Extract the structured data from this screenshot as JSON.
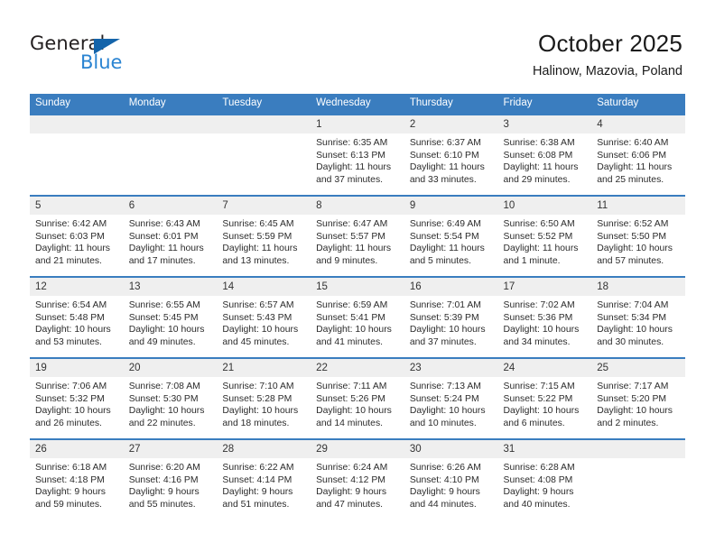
{
  "logo": {
    "word_dark": "General",
    "word_blue": "Blue",
    "triangle_color": "#1464aa",
    "blue_color": "#2a84d2"
  },
  "header": {
    "title": "October 2025",
    "subtitle": "Halinow, Mazovia, Poland"
  },
  "theme": {
    "header_row_bg": "#3a7dbf",
    "daynum_bg": "#efefef",
    "row_divider": "#3a7dbf"
  },
  "weekdays": [
    "Sunday",
    "Monday",
    "Tuesday",
    "Wednesday",
    "Thursday",
    "Friday",
    "Saturday"
  ],
  "labels": {
    "sunrise_prefix": "Sunrise:",
    "sunset_prefix": "Sunset:",
    "daylight_prefix": "Daylight:"
  },
  "weeks": [
    [
      {
        "day": "",
        "line1": "",
        "line2": "",
        "line3": "",
        "line4": ""
      },
      {
        "day": "",
        "line1": "",
        "line2": "",
        "line3": "",
        "line4": ""
      },
      {
        "day": "",
        "line1": "",
        "line2": "",
        "line3": "",
        "line4": ""
      },
      {
        "day": "1",
        "line1": "Sunrise: 6:35 AM",
        "line2": "Sunset: 6:13 PM",
        "line3": "Daylight: 11 hours",
        "line4": "and 37 minutes."
      },
      {
        "day": "2",
        "line1": "Sunrise: 6:37 AM",
        "line2": "Sunset: 6:10 PM",
        "line3": "Daylight: 11 hours",
        "line4": "and 33 minutes."
      },
      {
        "day": "3",
        "line1": "Sunrise: 6:38 AM",
        "line2": "Sunset: 6:08 PM",
        "line3": "Daylight: 11 hours",
        "line4": "and 29 minutes."
      },
      {
        "day": "4",
        "line1": "Sunrise: 6:40 AM",
        "line2": "Sunset: 6:06 PM",
        "line3": "Daylight: 11 hours",
        "line4": "and 25 minutes."
      }
    ],
    [
      {
        "day": "5",
        "line1": "Sunrise: 6:42 AM",
        "line2": "Sunset: 6:03 PM",
        "line3": "Daylight: 11 hours",
        "line4": "and 21 minutes."
      },
      {
        "day": "6",
        "line1": "Sunrise: 6:43 AM",
        "line2": "Sunset: 6:01 PM",
        "line3": "Daylight: 11 hours",
        "line4": "and 17 minutes."
      },
      {
        "day": "7",
        "line1": "Sunrise: 6:45 AM",
        "line2": "Sunset: 5:59 PM",
        "line3": "Daylight: 11 hours",
        "line4": "and 13 minutes."
      },
      {
        "day": "8",
        "line1": "Sunrise: 6:47 AM",
        "line2": "Sunset: 5:57 PM",
        "line3": "Daylight: 11 hours",
        "line4": "and 9 minutes."
      },
      {
        "day": "9",
        "line1": "Sunrise: 6:49 AM",
        "line2": "Sunset: 5:54 PM",
        "line3": "Daylight: 11 hours",
        "line4": "and 5 minutes."
      },
      {
        "day": "10",
        "line1": "Sunrise: 6:50 AM",
        "line2": "Sunset: 5:52 PM",
        "line3": "Daylight: 11 hours",
        "line4": "and 1 minute."
      },
      {
        "day": "11",
        "line1": "Sunrise: 6:52 AM",
        "line2": "Sunset: 5:50 PM",
        "line3": "Daylight: 10 hours",
        "line4": "and 57 minutes."
      }
    ],
    [
      {
        "day": "12",
        "line1": "Sunrise: 6:54 AM",
        "line2": "Sunset: 5:48 PM",
        "line3": "Daylight: 10 hours",
        "line4": "and 53 minutes."
      },
      {
        "day": "13",
        "line1": "Sunrise: 6:55 AM",
        "line2": "Sunset: 5:45 PM",
        "line3": "Daylight: 10 hours",
        "line4": "and 49 minutes."
      },
      {
        "day": "14",
        "line1": "Sunrise: 6:57 AM",
        "line2": "Sunset: 5:43 PM",
        "line3": "Daylight: 10 hours",
        "line4": "and 45 minutes."
      },
      {
        "day": "15",
        "line1": "Sunrise: 6:59 AM",
        "line2": "Sunset: 5:41 PM",
        "line3": "Daylight: 10 hours",
        "line4": "and 41 minutes."
      },
      {
        "day": "16",
        "line1": "Sunrise: 7:01 AM",
        "line2": "Sunset: 5:39 PM",
        "line3": "Daylight: 10 hours",
        "line4": "and 37 minutes."
      },
      {
        "day": "17",
        "line1": "Sunrise: 7:02 AM",
        "line2": "Sunset: 5:36 PM",
        "line3": "Daylight: 10 hours",
        "line4": "and 34 minutes."
      },
      {
        "day": "18",
        "line1": "Sunrise: 7:04 AM",
        "line2": "Sunset: 5:34 PM",
        "line3": "Daylight: 10 hours",
        "line4": "and 30 minutes."
      }
    ],
    [
      {
        "day": "19",
        "line1": "Sunrise: 7:06 AM",
        "line2": "Sunset: 5:32 PM",
        "line3": "Daylight: 10 hours",
        "line4": "and 26 minutes."
      },
      {
        "day": "20",
        "line1": "Sunrise: 7:08 AM",
        "line2": "Sunset: 5:30 PM",
        "line3": "Daylight: 10 hours",
        "line4": "and 22 minutes."
      },
      {
        "day": "21",
        "line1": "Sunrise: 7:10 AM",
        "line2": "Sunset: 5:28 PM",
        "line3": "Daylight: 10 hours",
        "line4": "and 18 minutes."
      },
      {
        "day": "22",
        "line1": "Sunrise: 7:11 AM",
        "line2": "Sunset: 5:26 PM",
        "line3": "Daylight: 10 hours",
        "line4": "and 14 minutes."
      },
      {
        "day": "23",
        "line1": "Sunrise: 7:13 AM",
        "line2": "Sunset: 5:24 PM",
        "line3": "Daylight: 10 hours",
        "line4": "and 10 minutes."
      },
      {
        "day": "24",
        "line1": "Sunrise: 7:15 AM",
        "line2": "Sunset: 5:22 PM",
        "line3": "Daylight: 10 hours",
        "line4": "and 6 minutes."
      },
      {
        "day": "25",
        "line1": "Sunrise: 7:17 AM",
        "line2": "Sunset: 5:20 PM",
        "line3": "Daylight: 10 hours",
        "line4": "and 2 minutes."
      }
    ],
    [
      {
        "day": "26",
        "line1": "Sunrise: 6:18 AM",
        "line2": "Sunset: 4:18 PM",
        "line3": "Daylight: 9 hours",
        "line4": "and 59 minutes."
      },
      {
        "day": "27",
        "line1": "Sunrise: 6:20 AM",
        "line2": "Sunset: 4:16 PM",
        "line3": "Daylight: 9 hours",
        "line4": "and 55 minutes."
      },
      {
        "day": "28",
        "line1": "Sunrise: 6:22 AM",
        "line2": "Sunset: 4:14 PM",
        "line3": "Daylight: 9 hours",
        "line4": "and 51 minutes."
      },
      {
        "day": "29",
        "line1": "Sunrise: 6:24 AM",
        "line2": "Sunset: 4:12 PM",
        "line3": "Daylight: 9 hours",
        "line4": "and 47 minutes."
      },
      {
        "day": "30",
        "line1": "Sunrise: 6:26 AM",
        "line2": "Sunset: 4:10 PM",
        "line3": "Daylight: 9 hours",
        "line4": "and 44 minutes."
      },
      {
        "day": "31",
        "line1": "Sunrise: 6:28 AM",
        "line2": "Sunset: 4:08 PM",
        "line3": "Daylight: 9 hours",
        "line4": "and 40 minutes."
      },
      {
        "day": "",
        "line1": "",
        "line2": "",
        "line3": "",
        "line4": ""
      }
    ]
  ]
}
